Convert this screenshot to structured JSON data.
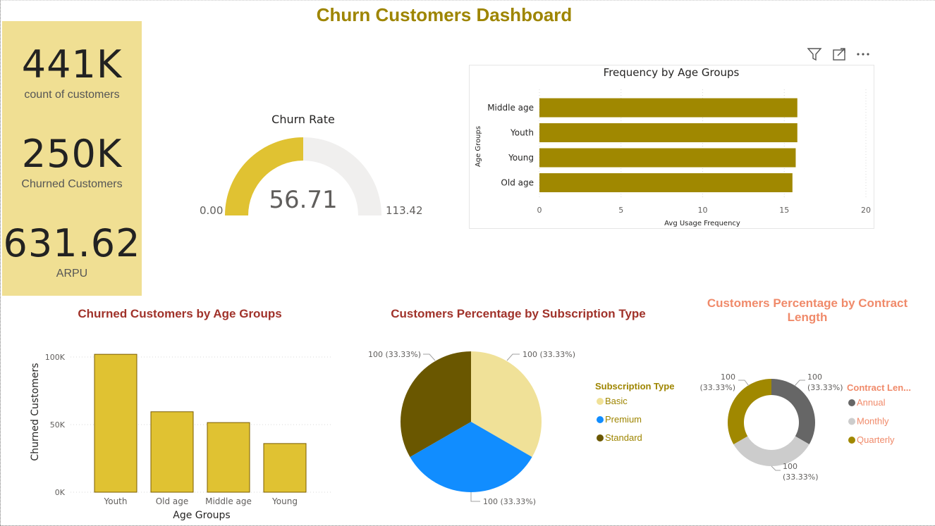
{
  "dashboard": {
    "title": "Churn Customers Dashboard"
  },
  "kpis": [
    {
      "value": "441K",
      "label": "count of customers"
    },
    {
      "value": "250K",
      "label": "Churned Customers"
    },
    {
      "value": "631.62",
      "label": "ARPU"
    }
  ],
  "toolbar": {
    "icons": [
      "filter-icon",
      "focus-mode-icon",
      "more-options-icon"
    ]
  },
  "colors": {
    "gold": "#9e8500",
    "gauge_fill": "#e0c232",
    "gauge_track": "#f0efee",
    "bar_gold": "#a08800",
    "bar_yellow": "#e0c232",
    "basic": "#f0e198",
    "premium": "#118dff",
    "standard": "#6a5700",
    "annual": "#666666",
    "monthly": "#cccccc",
    "quarterly": "#a08800",
    "section_red": "#a0322a",
    "section_salmon": "#f08a6a"
  },
  "chart_data": [
    {
      "id": "gauge",
      "type": "gauge",
      "title": "Churn Rate",
      "value": 56.71,
      "value_label": "56.71",
      "min": 0,
      "max": 113.42,
      "min_label": "0.00",
      "max_label": "113.42"
    },
    {
      "id": "freq",
      "type": "bar",
      "orientation": "horizontal",
      "title": "Frequency by Age Groups",
      "xlabel": "Avg Usage Frequency",
      "ylabel": "Age Groups",
      "categories": [
        "Middle age",
        "Youth",
        "Young",
        "Old age"
      ],
      "values": [
        15.8,
        15.8,
        15.7,
        15.5
      ],
      "xlim": [
        0,
        20
      ],
      "xticks": [
        0,
        5,
        10,
        15,
        20
      ],
      "xtick_labels": [
        "0",
        "5",
        "10",
        "15",
        "20"
      ],
      "grid": true
    },
    {
      "id": "churned",
      "type": "bar",
      "title": "Churned Customers by Age Groups",
      "xlabel": "Age Groups",
      "ylabel": "Churned Customers",
      "categories": [
        "Youth",
        "Old age",
        "Middle age",
        "Young"
      ],
      "values": [
        102000,
        59500,
        51500,
        36000
      ],
      "ylim": [
        0,
        100000
      ],
      "yticks": [
        0,
        50000,
        100000
      ],
      "ytick_labels": [
        "0K",
        "50K",
        "100K"
      ],
      "grid": true
    },
    {
      "id": "subscription",
      "type": "pie",
      "title": "Customers Percentage by Subscription Type",
      "legend_title": "Subscription Type",
      "labels": [
        "Basic",
        "Premium",
        "Standard"
      ],
      "values": [
        100,
        100,
        100
      ],
      "data_labels": [
        "100 (33.33%)",
        "100 (33.33%)",
        "100 (33.33%)"
      ],
      "legend_position": "right"
    },
    {
      "id": "contract",
      "type": "donut",
      "title": "Customers Percentage by Contract Length",
      "legend_title": "Contract Len...",
      "labels": [
        "Annual",
        "Monthly",
        "Quarterly"
      ],
      "values": [
        100,
        100,
        100
      ],
      "data_labels": [
        [
          "100",
          "(33.33%)"
        ],
        [
          "100",
          "(33.33%)"
        ],
        [
          "100",
          "(33.33%)"
        ]
      ],
      "legend_position": "right"
    }
  ]
}
